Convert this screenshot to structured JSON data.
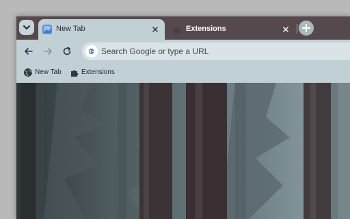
{
  "tabs": [
    {
      "label": "New Tab",
      "active": true
    },
    {
      "label": "Extensions",
      "active": false
    }
  ],
  "omnibox": {
    "placeholder": "Search Google or type a URL"
  },
  "bookmarks": [
    {
      "label": "New Tab",
      "icon": "globe-icon"
    },
    {
      "label": "Extensions",
      "icon": "puzzle-icon"
    }
  ],
  "colors": {
    "tabstrip": "#55494d",
    "toolbar": "#c1d0d4",
    "omnibox": "#dae4e6"
  }
}
